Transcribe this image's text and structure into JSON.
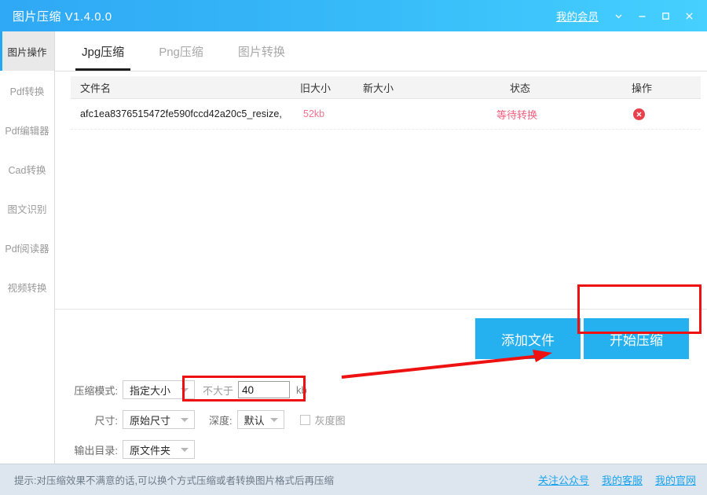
{
  "titlebar": {
    "app_title": "图片压缩 V1.4.0.0",
    "member_link": "我的会员",
    "icons": {
      "chevron": "chevron-down-icon",
      "minimize": "minimize-icon",
      "maximize": "maximize-icon",
      "close": "close-icon"
    }
  },
  "sidebar": {
    "items": [
      {
        "label": "图片操作",
        "active": true
      },
      {
        "label": "Pdf转换",
        "active": false
      },
      {
        "label": "Pdf编辑器",
        "active": false
      },
      {
        "label": "Cad转换",
        "active": false
      },
      {
        "label": "图文识别",
        "active": false
      },
      {
        "label": "Pdf阅读器",
        "active": false
      },
      {
        "label": "视频转换",
        "active": false
      }
    ]
  },
  "tabs": [
    {
      "label": "Jpg压缩",
      "active": true
    },
    {
      "label": "Png压缩",
      "active": false
    },
    {
      "label": "图片转换",
      "active": false
    }
  ],
  "table": {
    "headers": {
      "filename": "文件名",
      "old_size": "旧大小",
      "new_size": "新大小",
      "status": "状态",
      "action": "操作"
    },
    "rows": [
      {
        "filename": "afc1ea8376515472fe590fccd42a20c5_resize,",
        "old_size": "52kb",
        "new_size": "",
        "status": "等待转换",
        "action_icon": "delete-circle-icon"
      }
    ]
  },
  "actions": {
    "add_file": "添加文件",
    "start_compress": "开始压缩"
  },
  "settings": {
    "mode_label": "压缩模式:",
    "mode_value": "指定大小",
    "limit_label": "不大于",
    "limit_value": "40",
    "limit_unit": "kb",
    "size_label": "尺寸:",
    "size_value": "原始尺寸",
    "depth_label": "深度:",
    "depth_value": "默认",
    "gray_label": "灰度图",
    "gray_checked": false,
    "output_label": "输出目录:",
    "output_value": "原文件夹"
  },
  "footer": {
    "tip": "提示:对压缩效果不满意的话,可以换个方式压缩或者转换图片格式后再压缩",
    "links": [
      "关注公众号",
      "我的客服",
      "我的官网"
    ]
  },
  "colors": {
    "title_gradient_start": "#2fa8f5",
    "title_gradient_end": "#45d0ff",
    "accent_blue": "#25b0ef",
    "annotation_red": "#ee1111",
    "status_red": "#ef5f7d",
    "size_pink": "#f4748f",
    "footer_bg": "#dde6ee"
  }
}
